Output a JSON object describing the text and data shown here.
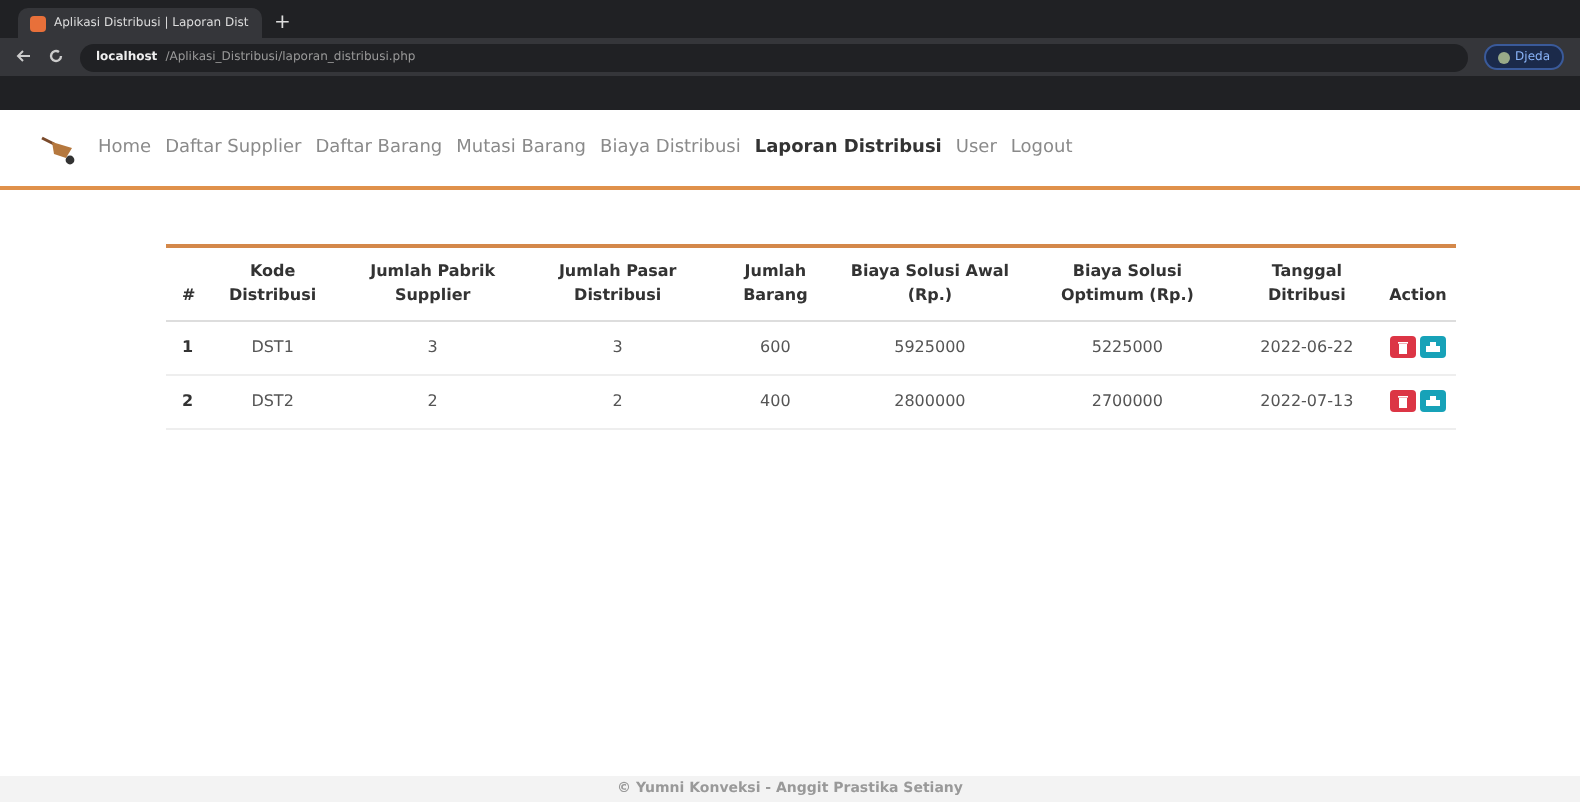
{
  "browser": {
    "tab_title": "Aplikasi Distribusi | Laporan Dist",
    "new_tab": "+",
    "url_host": "localhost",
    "url_path": "/Aplikasi_Distribusi/laporan_distribusi.php",
    "profile": "Djeda"
  },
  "nav": [
    {
      "label": "Home",
      "selected": false
    },
    {
      "label": "Daftar Supplier",
      "selected": false
    },
    {
      "label": "Daftar Barang",
      "selected": false
    },
    {
      "label": "Mutasi Barang",
      "selected": false
    },
    {
      "label": "Biaya Distribusi",
      "selected": false
    },
    {
      "label": "Laporan Distribusi",
      "selected": true
    },
    {
      "label": "User",
      "selected": false
    },
    {
      "label": "Logout",
      "selected": false
    }
  ],
  "table": {
    "columns": [
      "#",
      "Kode Distribusi",
      "Jumlah Pabrik Supplier",
      "Jumlah Pasar Distribusi",
      "Jumlah Barang",
      "Biaya Solusi Awal (Rp.)",
      "Biaya Solusi Optimum (Rp.)",
      "Tanggal Ditribusi",
      "Action"
    ],
    "rows": [
      {
        "cells": [
          "1",
          "DST1",
          "3",
          "3",
          "600",
          "5925000",
          "5225000",
          "2022-06-22"
        ]
      },
      {
        "cells": [
          "2",
          "DST2",
          "2",
          "2",
          "400",
          "2800000",
          "2700000",
          "2022-07-13"
        ]
      }
    ]
  },
  "footer": "© Yumni Konveksi - Anggit Prastika Setiany"
}
